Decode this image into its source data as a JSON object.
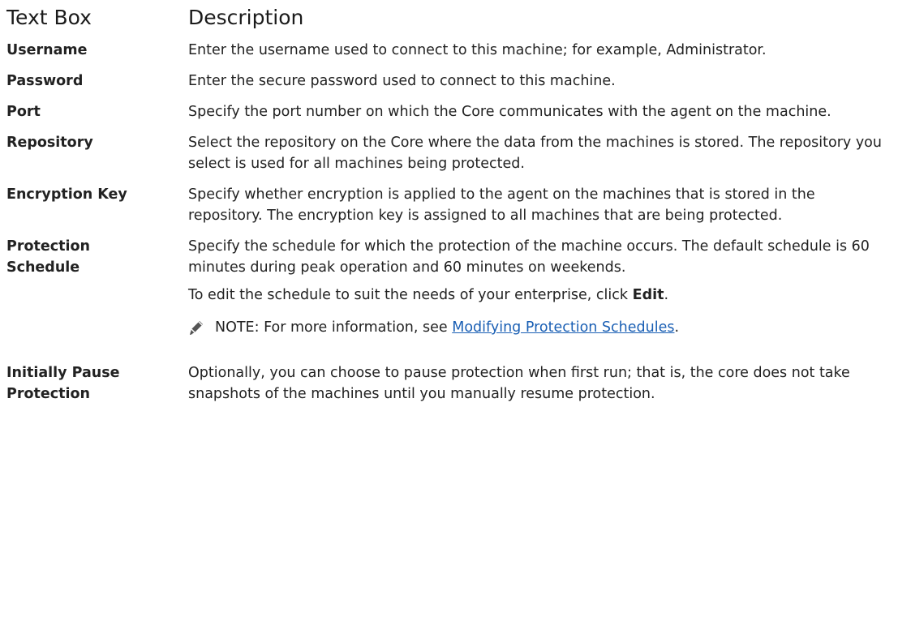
{
  "header": {
    "col1": "Text Box",
    "col2": "Description"
  },
  "rows": [
    {
      "label": "Username",
      "text": "Enter the username used to connect to this machine; for example, Administrator."
    },
    {
      "label": "Password",
      "text": "Enter the secure password used to connect to this machine."
    },
    {
      "label": "Port",
      "text": "Specify the port number on which the Core communicates with the agent on the machine."
    },
    {
      "label": "Repository",
      "text": "Select the repository on the Core where the data from the machines is stored. The repository you select is used for all machines being protected."
    },
    {
      "label": "Encryption Key",
      "text": "Specify whether encryption is applied to the agent on the machines that is stored in the repository. The encryption key is assigned to all machines that are being protected."
    },
    {
      "label": "Protection Schedule",
      "text": "Specify the schedule for which the protection of the machine occurs. The default schedule is 60 minutes during peak operation and 60 minutes on weekends.",
      "text2_prefix": "To edit the schedule to suit the needs of your enterprise, click ",
      "text2_bold": "Edit",
      "text2_suffix": ".",
      "note": {
        "icon": "pencil-note-icon",
        "label": "NOTE:",
        "text": " For more information, see ",
        "link": "Modifying Protection Schedules",
        "suffix": "."
      }
    },
    {
      "label": "Initially Pause Protection",
      "text": "Optionally, you can choose to pause protection when first run; that is, the core does not take snapshots of the machines until you manually resume protection."
    }
  ],
  "colors": {
    "text": "#222222",
    "link": "#1a5fb4"
  }
}
